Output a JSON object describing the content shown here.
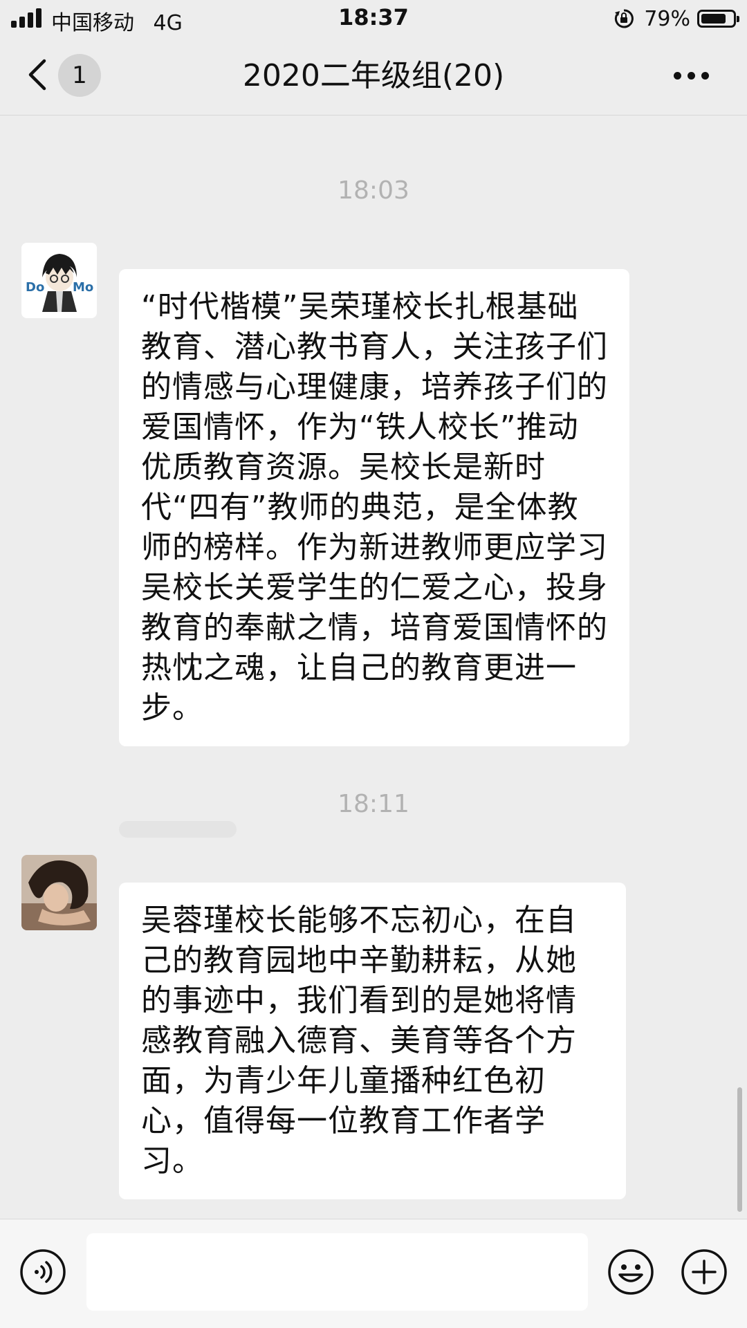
{
  "status_bar": {
    "carrier": "中国移动",
    "network": "4G",
    "time": "18:37",
    "battery": "79%",
    "battery_level": 0.79
  },
  "nav": {
    "back_icon": "chevron-left-icon",
    "unread_count": "1",
    "title": "2020二年级组(20)",
    "more_icon": "more-icon"
  },
  "messages": [
    {
      "timestamp": "18:03",
      "avatar": "cartoon-avatar",
      "text": "“时代楷模”吴荣瑾校长扎根基础教育、潜心教书育人，关注孩子们的情感与心理健康，培养孩子们的爱国情怀，作为“铁人校长”推动优质教育资源。吴校长是新时代“四有”教师的典范，是全体教师的榜样。作为新进教师更应学习吴校长关爱学生的仁爱之心，投身教育的奉献之情，培育爱国情怀的热忱之魂，让自己的教育更进一步。"
    },
    {
      "timestamp": "18:11",
      "avatar": "photo-avatar",
      "text": "吴蓉瑾校长能够不忘初心，在自己的教育园地中辛勤耕耘，从她的事迹中，我们看到的是她将情感教育融入德育、美育等各个方面，为青少年儿童播种红色初心，值得每一位教育工作者学习。"
    }
  ],
  "input_bar": {
    "voice_icon": "voice-icon",
    "input_value": "",
    "emoji_icon": "emoji-icon",
    "plus_icon": "plus-icon"
  }
}
